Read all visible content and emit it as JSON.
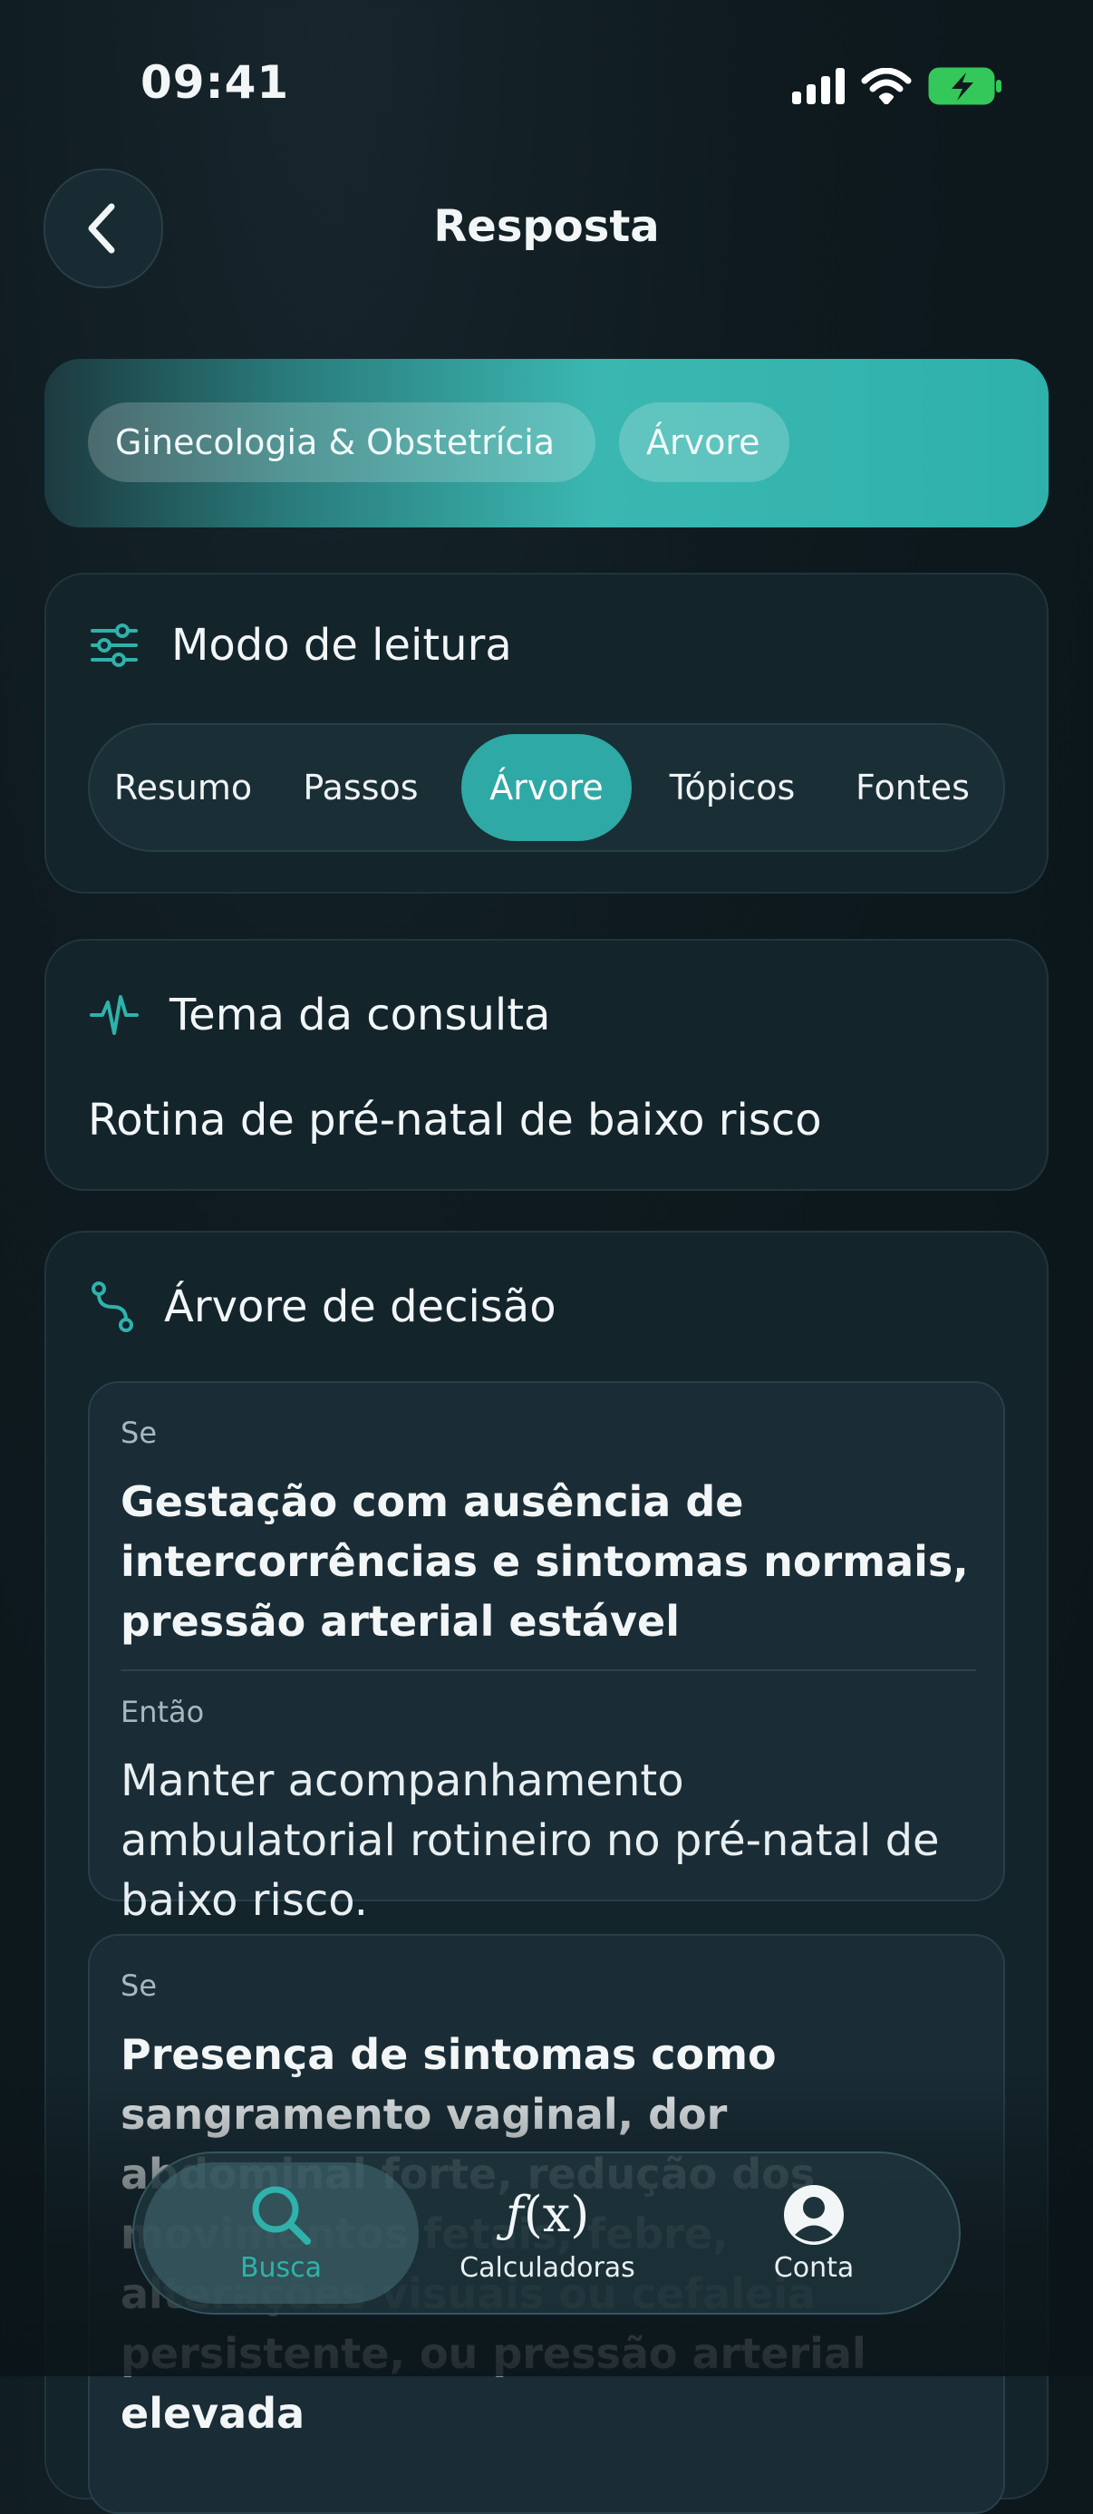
{
  "status_bar": {
    "time": "09:41"
  },
  "header": {
    "title": "Resposta"
  },
  "banner": {
    "chips": [
      "Ginecologia & Obstetrícia",
      "Árvore"
    ]
  },
  "reading_mode": {
    "title": "Modo de leitura",
    "options": [
      "Resumo",
      "Passos",
      "Árvore",
      "Tópicos",
      "Fontes"
    ],
    "selected": "Árvore"
  },
  "topic": {
    "title": "Tema da consulta",
    "value": "Rotina de pré-natal de baixo risco"
  },
  "decision_tree": {
    "title": "Árvore de decisão",
    "nodes": [
      {
        "if_label": "Se",
        "condition": "Gestação com ausência de intercorrências e sintomas normais, pressão arterial estável",
        "then_label": "Então",
        "action": "Manter acompanhamento ambulatorial rotineiro no pré-natal de baixo risco."
      },
      {
        "if_label": "Se",
        "condition": "Presença de sintomas como sangramento vaginal, dor abdominal forte, redução dos movimentos fetais, febre, alterações visuais ou cefaleia persistente, ou pressão arterial elevada"
      }
    ]
  },
  "tab_bar": {
    "tabs": [
      {
        "label": "Busca",
        "icon": "search-icon",
        "active": true
      },
      {
        "label": "Calculadoras",
        "icon": "function-icon",
        "active": false
      },
      {
        "label": "Conta",
        "icon": "account-icon",
        "active": false
      }
    ],
    "accent": "#2fb2ab"
  },
  "colors": {
    "accent": "#2ea9a5",
    "background": "#0e1a1f"
  }
}
